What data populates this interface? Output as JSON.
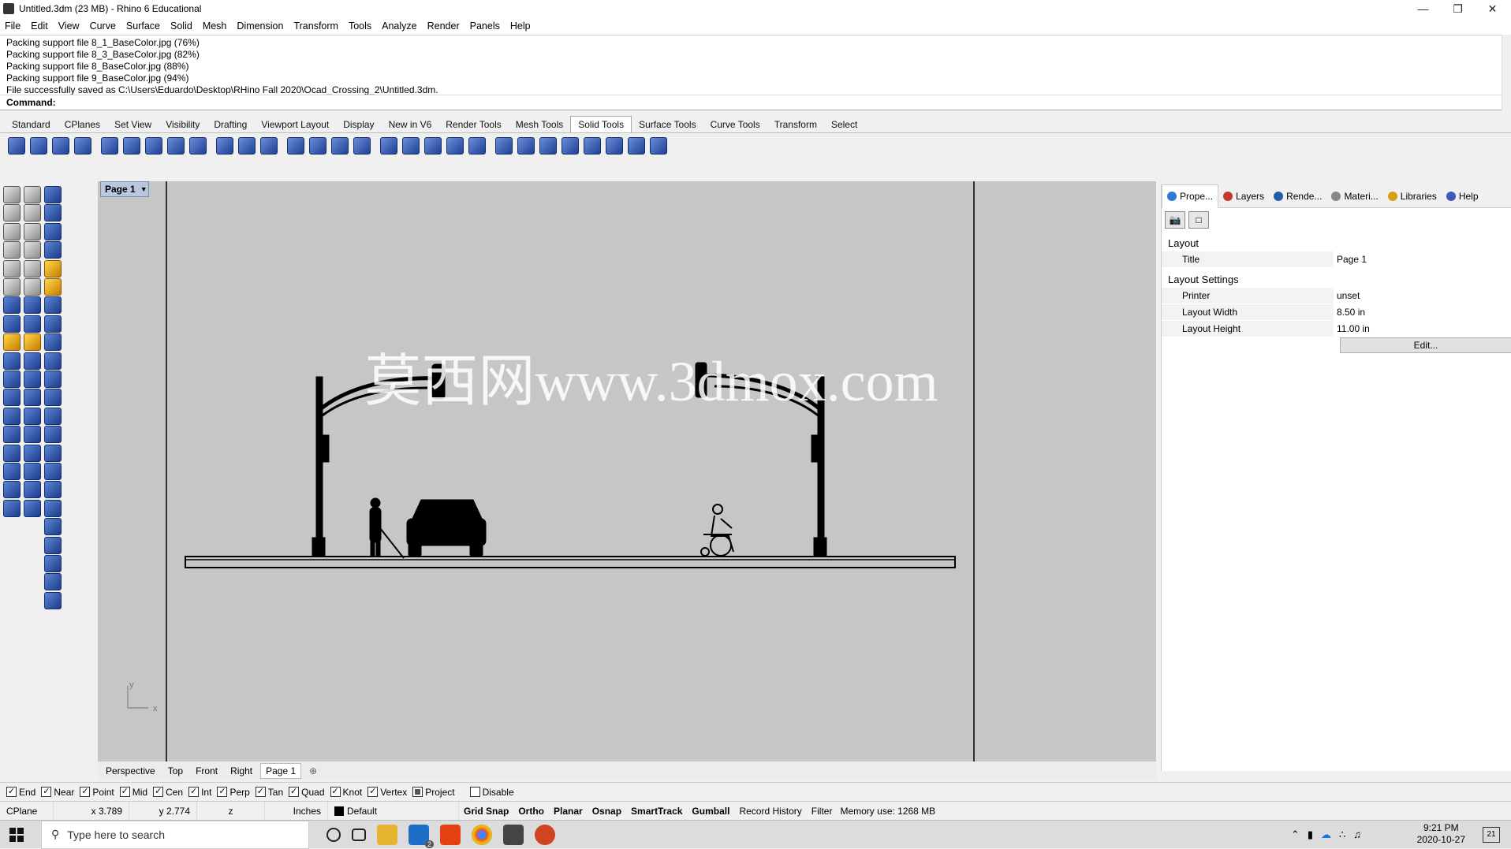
{
  "window": {
    "title": "Untitled.3dm (23 MB) - Rhino 6 Educational"
  },
  "menu": [
    "File",
    "Edit",
    "View",
    "Curve",
    "Surface",
    "Solid",
    "Mesh",
    "Dimension",
    "Transform",
    "Tools",
    "Analyze",
    "Render",
    "Panels",
    "Help"
  ],
  "command_history": [
    "Packing support file 8_1_BaseColor.jpg (76%)",
    "Packing support file 8_3_BaseColor.jpg (82%)",
    "Packing support file 8_BaseColor.jpg (88%)",
    "Packing support file 9_BaseColor.jpg (94%)",
    "File successfully saved as C:\\Users\\Eduardo\\Desktop\\RHino Fall 2020\\Ocad_Crossing_2\\Untitled.3dm."
  ],
  "command_prompt": "Command:",
  "toolbar_tabs": [
    "Standard",
    "CPlanes",
    "Set View",
    "Visibility",
    "Drafting",
    "Viewport Layout",
    "Display",
    "New in V6",
    "Render Tools",
    "Mesh Tools",
    "Solid Tools",
    "Surface Tools",
    "Curve Tools",
    "Transform",
    "Select"
  ],
  "active_toolbar_tab": "Solid Tools",
  "viewport": {
    "page_tab": "Page 1",
    "watermark": "莫西网www.3dmox.com",
    "axis_x": "x",
    "axis_y": "y"
  },
  "viewport_tabs": [
    "Perspective",
    "Top",
    "Front",
    "Right",
    "Page 1"
  ],
  "right_panel": {
    "tabs": [
      "Prope...",
      "Layers",
      "Rende...",
      "Materi...",
      "Libraries",
      "Help"
    ],
    "sections": [
      {
        "title": "Layout",
        "rows": [
          {
            "label": "Title",
            "value": "Page 1"
          }
        ]
      },
      {
        "title": "Layout Settings",
        "rows": [
          {
            "label": "Printer",
            "value": "unset"
          },
          {
            "label": "Layout Width",
            "value": "8.50 in"
          },
          {
            "label": "Layout Height",
            "value": "11.00 in"
          }
        ]
      }
    ],
    "edit_button": "Edit..."
  },
  "osnaps": [
    {
      "label": "End",
      "checked": true
    },
    {
      "label": "Near",
      "checked": true
    },
    {
      "label": "Point",
      "checked": true
    },
    {
      "label": "Mid",
      "checked": true
    },
    {
      "label": "Cen",
      "checked": true
    },
    {
      "label": "Int",
      "checked": true
    },
    {
      "label": "Perp",
      "checked": true
    },
    {
      "label": "Tan",
      "checked": true
    },
    {
      "label": "Quad",
      "checked": true
    },
    {
      "label": "Knot",
      "checked": true
    },
    {
      "label": "Vertex",
      "checked": true
    },
    {
      "label": "Project",
      "checked": false
    },
    {
      "label": "Disable",
      "checked": false
    }
  ],
  "status": {
    "cplane": "CPlane",
    "x": "x 3.789",
    "y": "y 2.774",
    "z": "z",
    "units": "Inches",
    "layer": "Default",
    "toggles": [
      "Grid Snap",
      "Ortho",
      "Planar",
      "Osnap",
      "SmartTrack",
      "Gumball"
    ],
    "record_history": "Record History",
    "filter": "Filter",
    "memory": "Memory use: 1268 MB"
  },
  "taskbar": {
    "search_placeholder": "Type here to search",
    "time": "9:21 PM",
    "date": "2020-10-27",
    "notification_count": "21",
    "mail_badge": "2"
  }
}
